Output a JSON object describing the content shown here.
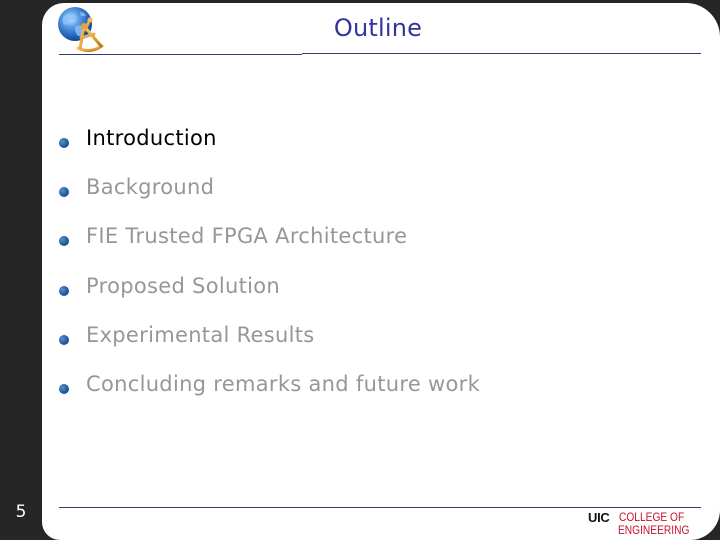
{
  "slide": {
    "title": "Outline",
    "number": "5",
    "logo_icon": "globe-sextant-icon",
    "colors": {
      "title": "#33339e",
      "active_item": "#000000",
      "inactive_item": "#979797",
      "bullet": "#22599e",
      "rule": "#3b3a6e",
      "background_frame": "#262626",
      "uic_red": "#c8102e"
    }
  },
  "outline": {
    "items": [
      {
        "label": "Introduction",
        "active": true
      },
      {
        "label": "Background",
        "active": false
      },
      {
        "label": "FIE Trusted FPGA Architecture",
        "active": false
      },
      {
        "label": "Proposed Solution",
        "active": false
      },
      {
        "label": "Experimental Results",
        "active": false
      },
      {
        "label": "Concluding remarks and future work",
        "active": false
      }
    ]
  },
  "footer": {
    "uic_mark": "UIC",
    "college_line1": "COLLEGE OF",
    "college_line2": "ENGINEERING"
  }
}
